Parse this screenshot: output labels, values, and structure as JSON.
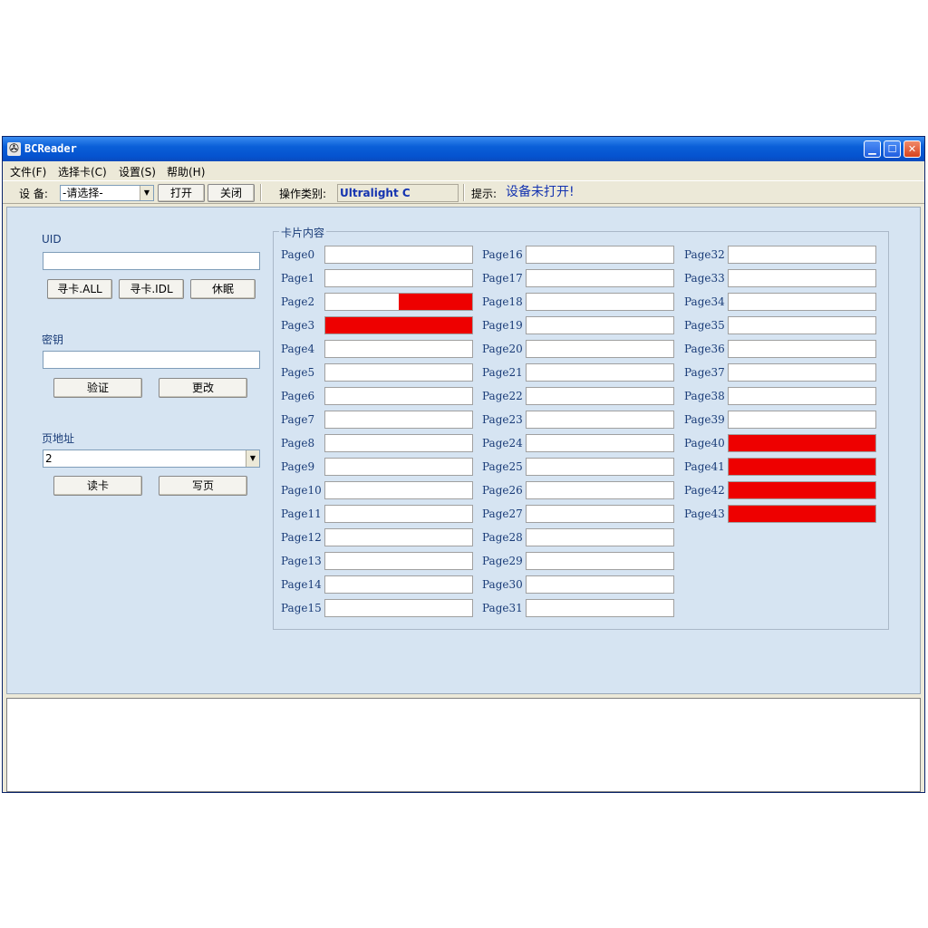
{
  "window": {
    "title": "BCReader"
  },
  "menu": [
    {
      "label": "文件(F)"
    },
    {
      "label": "选择卡(C)"
    },
    {
      "label": "设置(S)"
    },
    {
      "label": "帮助(H)"
    }
  ],
  "toolbar": {
    "device_label": "设 备:",
    "device_value": "-请选择-",
    "open_label": "打开",
    "close_label": "关闭",
    "op_type_label": "操作类别:",
    "op_type_value": "Ultralight C",
    "hint_label": "提示:",
    "hint_value": "设备未打开!"
  },
  "left": {
    "uid_label": "UID",
    "uid_value": "",
    "find_all_label": "寻卡.ALL",
    "find_idl_label": "寻卡.IDL",
    "sleep_label": "休眠",
    "key_label": "密钥",
    "key_value": "",
    "verify_label": "验证",
    "change_label": "更改",
    "page_addr_label": "页地址",
    "page_addr_value": "2",
    "read_label": "读卡",
    "write_label": "写页"
  },
  "card": {
    "title": "卡片内容",
    "pages": [
      {
        "label": "Page0",
        "fill": 0
      },
      {
        "label": "Page1",
        "fill": 0
      },
      {
        "label": "Page2",
        "fill": 0.5
      },
      {
        "label": "Page3",
        "fill": 1
      },
      {
        "label": "Page4",
        "fill": 0
      },
      {
        "label": "Page5",
        "fill": 0
      },
      {
        "label": "Page6",
        "fill": 0
      },
      {
        "label": "Page7",
        "fill": 0
      },
      {
        "label": "Page8",
        "fill": 0
      },
      {
        "label": "Page9",
        "fill": 0
      },
      {
        "label": "Page10",
        "fill": 0
      },
      {
        "label": "Page11",
        "fill": 0
      },
      {
        "label": "Page12",
        "fill": 0
      },
      {
        "label": "Page13",
        "fill": 0
      },
      {
        "label": "Page14",
        "fill": 0
      },
      {
        "label": "Page15",
        "fill": 0
      },
      {
        "label": "Page16",
        "fill": 0
      },
      {
        "label": "Page17",
        "fill": 0
      },
      {
        "label": "Page18",
        "fill": 0
      },
      {
        "label": "Page19",
        "fill": 0
      },
      {
        "label": "Page20",
        "fill": 0
      },
      {
        "label": "Page21",
        "fill": 0
      },
      {
        "label": "Page22",
        "fill": 0
      },
      {
        "label": "Page23",
        "fill": 0
      },
      {
        "label": "Page24",
        "fill": 0
      },
      {
        "label": "Page25",
        "fill": 0
      },
      {
        "label": "Page26",
        "fill": 0
      },
      {
        "label": "Page27",
        "fill": 0
      },
      {
        "label": "Page28",
        "fill": 0
      },
      {
        "label": "Page29",
        "fill": 0
      },
      {
        "label": "Page30",
        "fill": 0
      },
      {
        "label": "Page31",
        "fill": 0
      },
      {
        "label": "Page32",
        "fill": 0
      },
      {
        "label": "Page33",
        "fill": 0
      },
      {
        "label": "Page34",
        "fill": 0
      },
      {
        "label": "Page35",
        "fill": 0
      },
      {
        "label": "Page36",
        "fill": 0
      },
      {
        "label": "Page37",
        "fill": 0
      },
      {
        "label": "Page38",
        "fill": 0
      },
      {
        "label": "Page39",
        "fill": 0
      },
      {
        "label": "Page40",
        "fill": 1
      },
      {
        "label": "Page41",
        "fill": 1
      },
      {
        "label": "Page42",
        "fill": 1
      },
      {
        "label": "Page43",
        "fill": 1
      }
    ]
  },
  "colors": {
    "locked_fill": "#ee0000",
    "client_bg": "#d6e4f2",
    "title_bar": "#0a5fd8"
  },
  "log": {
    "text": ""
  }
}
